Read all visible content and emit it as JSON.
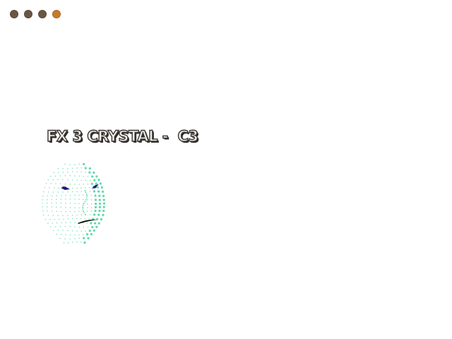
{
  "window_dots": [
    {
      "name": "dot-1",
      "color": "#6b5644"
    },
    {
      "name": "dot-2",
      "color": "#6b5644"
    },
    {
      "name": "dot-3",
      "color": "#6b5644"
    },
    {
      "name": "dot-4",
      "color": "#c87a2a"
    }
  ],
  "title": "FX 3 CRYSTAL -  C3",
  "face_mesh": {
    "point_color": "#4ed6a0",
    "eye_color": "#1a1a7a",
    "mouth_color": "#111111"
  }
}
